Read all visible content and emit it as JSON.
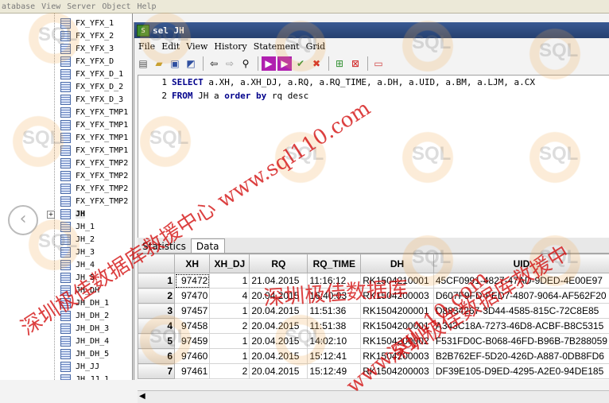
{
  "menubar": {
    "items": [
      "atabase",
      "View",
      "Server",
      "Object",
      "Help"
    ]
  },
  "tree": {
    "items": [
      "FX_YFX_1",
      "FX_YFX_2",
      "FX_YFX_3",
      "FX_YFX_D",
      "FX_YFX_D_1",
      "FX_YFX_D_2",
      "FX_YFX_D_3",
      "FX_YFX_TMP1",
      "FX_YFX_TMP1",
      "FX_YFX_TMP1",
      "FX_YFX_TMP1",
      "FX_YFX_TMP2",
      "FX_YFX_TMP2",
      "FX_YFX_TMP2",
      "FX_YFX_TMP2",
      "JH",
      "JH_1",
      "JH_2",
      "JH_3",
      "JH_4",
      "JH_5",
      "JH_DH",
      "JH_DH_1",
      "JH_DH_2",
      "JH_DH_3",
      "JH_DH_4",
      "JH_DH_5",
      "JH_JJ",
      "JH_JJ_1"
    ],
    "selected_index": 15
  },
  "window": {
    "title": "sel JH",
    "menu": [
      "File",
      "Edit",
      "View",
      "History",
      "Statement",
      "Grid"
    ]
  },
  "toolbar": {
    "icons": [
      "new-icon",
      "open-icon",
      "save-icon",
      "save-as-icon",
      "back-icon",
      "forward-icon",
      "find-icon",
      "execute-icon",
      "execute-script-icon",
      "commit-icon",
      "rollback-icon",
      "grid-refresh-icon",
      "grid-stop-icon",
      "grid-options-icon"
    ]
  },
  "editor": {
    "line1_no": "1",
    "line1_kw": "SELECT",
    "line1_rest": " a.XH, a.XH_DJ, a.RQ, a.RQ_TIME, a.DH, a.UID, a.BM, a.LJM, a.CX",
    "line2_no": "2",
    "line2_kw1": "FROM",
    "line2_mid": " JH a ",
    "line2_kw2": "order by",
    "line2_rest": " rq desc"
  },
  "tabs": [
    "Statistics",
    "Data"
  ],
  "active_tab": "Data",
  "grid": {
    "columns": [
      "",
      "XH",
      "XH_DJ",
      "RQ",
      "RQ_TIME",
      "DH",
      "UID"
    ],
    "rows": [
      [
        "1",
        "97472",
        "1",
        "21.04.2015",
        "11:16:12",
        "RK1504210001",
        "45CF0991-4827-47AD-9DED-4E00E97"
      ],
      [
        "2",
        "97470",
        "4",
        "20.04.2015",
        "16:40:03",
        "RK1504200003",
        "D607F9FD-FED7-4807-9064-AF562F20"
      ],
      [
        "3",
        "97457",
        "1",
        "20.04.2015",
        "11:51:36",
        "RK1504200001",
        "D8834267-3D44-4585-815C-72C8E85"
      ],
      [
        "4",
        "97458",
        "2",
        "20.04.2015",
        "11:51:38",
        "RK1504200001",
        "A343C18A-7273-46D8-ACBF-B8C5315"
      ],
      [
        "5",
        "97459",
        "1",
        "20.04.2015",
        "14:02:10",
        "RK1504200002",
        "F531FD0C-B068-46FD-B96B-7B288059"
      ],
      [
        "6",
        "97460",
        "1",
        "20.04.2015",
        "15:12:41",
        "RK1504200003",
        "B2B762EF-5D20-426D-A887-0DB8FD6"
      ],
      [
        "7",
        "97461",
        "2",
        "20.04.2015",
        "15:12:49",
        "RK1504200003",
        "DF39E105-D9ED-4295-A2E0-94DE185"
      ]
    ]
  },
  "watermarks": {
    "text_left": "深圳极佳数据库救援中心 www.sql110.com",
    "text_right": "深圳极佳数据库救援中",
    "text_center": "深圳极佳数据库",
    "text_bottom": "www.sql110.com",
    "logo_text": "SQL"
  }
}
